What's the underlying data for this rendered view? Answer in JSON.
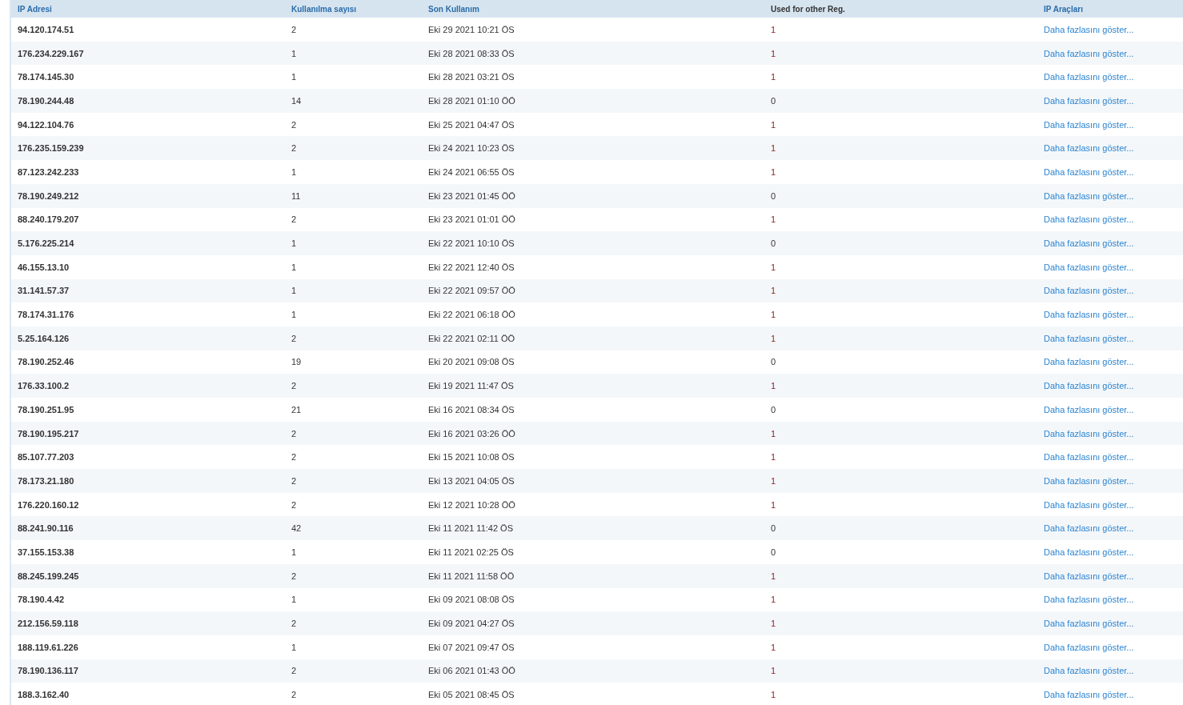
{
  "table": {
    "columns": [
      "IP Adresi",
      "Kullanılma sayısı",
      "Son Kullanım",
      "Used for other Reg.",
      "IP Araçları"
    ],
    "rows": [
      {
        "ip": "94.120.174.51",
        "count": "2",
        "last_used": "Eki 29 2021 10:21 ÖS",
        "other_reg": "1",
        "flagged": true,
        "link": "Daha fazlasını göster..."
      },
      {
        "ip": "176.234.229.167",
        "count": "1",
        "last_used": "Eki 28 2021 08:33 ÖS",
        "other_reg": "1",
        "flagged": true,
        "link": "Daha fazlasını göster..."
      },
      {
        "ip": "78.174.145.30",
        "count": "1",
        "last_used": "Eki 28 2021 03:21 ÖS",
        "other_reg": "1",
        "flagged": true,
        "link": "Daha fazlasını göster..."
      },
      {
        "ip": "78.190.244.48",
        "count": "14",
        "last_used": "Eki 28 2021 01:10 ÖÖ",
        "other_reg": "0",
        "flagged": false,
        "link": "Daha fazlasını göster..."
      },
      {
        "ip": "94.122.104.76",
        "count": "2",
        "last_used": "Eki 25 2021 04:47 ÖS",
        "other_reg": "1",
        "flagged": true,
        "link": "Daha fazlasını göster..."
      },
      {
        "ip": "176.235.159.239",
        "count": "2",
        "last_used": "Eki 24 2021 10:23 ÖS",
        "other_reg": "1",
        "flagged": true,
        "link": "Daha fazlasını göster..."
      },
      {
        "ip": "87.123.242.233",
        "count": "1",
        "last_used": "Eki 24 2021 06:55 ÖS",
        "other_reg": "1",
        "flagged": true,
        "link": "Daha fazlasını göster..."
      },
      {
        "ip": "78.190.249.212",
        "count": "11",
        "last_used": "Eki 23 2021 01:45 ÖÖ",
        "other_reg": "0",
        "flagged": false,
        "link": "Daha fazlasını göster..."
      },
      {
        "ip": "88.240.179.207",
        "count": "2",
        "last_used": "Eki 23 2021 01:01 ÖÖ",
        "other_reg": "1",
        "flagged": true,
        "link": "Daha fazlasını göster..."
      },
      {
        "ip": "5.176.225.214",
        "count": "1",
        "last_used": "Eki 22 2021 10:10 ÖS",
        "other_reg": "0",
        "flagged": false,
        "link": "Daha fazlasını göster..."
      },
      {
        "ip": "46.155.13.10",
        "count": "1",
        "last_used": "Eki 22 2021 12:40 ÖS",
        "other_reg": "1",
        "flagged": true,
        "link": "Daha fazlasını göster..."
      },
      {
        "ip": "31.141.57.37",
        "count": "1",
        "last_used": "Eki 22 2021 09:57 ÖÖ",
        "other_reg": "1",
        "flagged": true,
        "link": "Daha fazlasını göster..."
      },
      {
        "ip": "78.174.31.176",
        "count": "1",
        "last_used": "Eki 22 2021 06:18 ÖÖ",
        "other_reg": "1",
        "flagged": true,
        "link": "Daha fazlasını göster..."
      },
      {
        "ip": "5.25.164.126",
        "count": "2",
        "last_used": "Eki 22 2021 02:11 ÖÖ",
        "other_reg": "1",
        "flagged": true,
        "link": "Daha fazlasını göster..."
      },
      {
        "ip": "78.190.252.46",
        "count": "19",
        "last_used": "Eki 20 2021 09:08 ÖS",
        "other_reg": "0",
        "flagged": false,
        "link": "Daha fazlasını göster..."
      },
      {
        "ip": "176.33.100.2",
        "count": "2",
        "last_used": "Eki 19 2021 11:47 ÖS",
        "other_reg": "1",
        "flagged": true,
        "link": "Daha fazlasını göster..."
      },
      {
        "ip": "78.190.251.95",
        "count": "21",
        "last_used": "Eki 16 2021 08:34 ÖS",
        "other_reg": "0",
        "flagged": false,
        "link": "Daha fazlasını göster..."
      },
      {
        "ip": "78.190.195.217",
        "count": "2",
        "last_used": "Eki 16 2021 03:26 ÖÖ",
        "other_reg": "1",
        "flagged": true,
        "link": "Daha fazlasını göster..."
      },
      {
        "ip": "85.107.77.203",
        "count": "2",
        "last_used": "Eki 15 2021 10:08 ÖS",
        "other_reg": "1",
        "flagged": true,
        "link": "Daha fazlasını göster..."
      },
      {
        "ip": "78.173.21.180",
        "count": "2",
        "last_used": "Eki 13 2021 04:05 ÖS",
        "other_reg": "1",
        "flagged": true,
        "link": "Daha fazlasını göster..."
      },
      {
        "ip": "176.220.160.12",
        "count": "2",
        "last_used": "Eki 12 2021 10:28 ÖÖ",
        "other_reg": "1",
        "flagged": true,
        "link": "Daha fazlasını göster..."
      },
      {
        "ip": "88.241.90.116",
        "count": "42",
        "last_used": "Eki 11 2021 11:42 ÖS",
        "other_reg": "0",
        "flagged": false,
        "link": "Daha fazlasını göster..."
      },
      {
        "ip": "37.155.153.38",
        "count": "1",
        "last_used": "Eki 11 2021 02:25 ÖS",
        "other_reg": "0",
        "flagged": false,
        "link": "Daha fazlasını göster..."
      },
      {
        "ip": "88.245.199.245",
        "count": "2",
        "last_used": "Eki 11 2021 11:58 ÖÖ",
        "other_reg": "1",
        "flagged": true,
        "link": "Daha fazlasını göster..."
      },
      {
        "ip": "78.190.4.42",
        "count": "1",
        "last_used": "Eki 09 2021 08:08 ÖS",
        "other_reg": "1",
        "flagged": true,
        "link": "Daha fazlasını göster..."
      },
      {
        "ip": "212.156.59.118",
        "count": "2",
        "last_used": "Eki 09 2021 04:27 ÖS",
        "other_reg": "1",
        "flagged": true,
        "link": "Daha fazlasını göster..."
      },
      {
        "ip": "188.119.61.226",
        "count": "1",
        "last_used": "Eki 07 2021 09:47 ÖS",
        "other_reg": "1",
        "flagged": true,
        "link": "Daha fazlasını göster..."
      },
      {
        "ip": "78.190.136.117",
        "count": "2",
        "last_used": "Eki 06 2021 01:43 ÖÖ",
        "other_reg": "1",
        "flagged": true,
        "link": "Daha fazlasını göster..."
      },
      {
        "ip": "188.3.162.40",
        "count": "2",
        "last_used": "Eki 05 2021 08:45 ÖS",
        "other_reg": "1",
        "flagged": true,
        "link": "Daha fazlasını göster..."
      }
    ]
  }
}
